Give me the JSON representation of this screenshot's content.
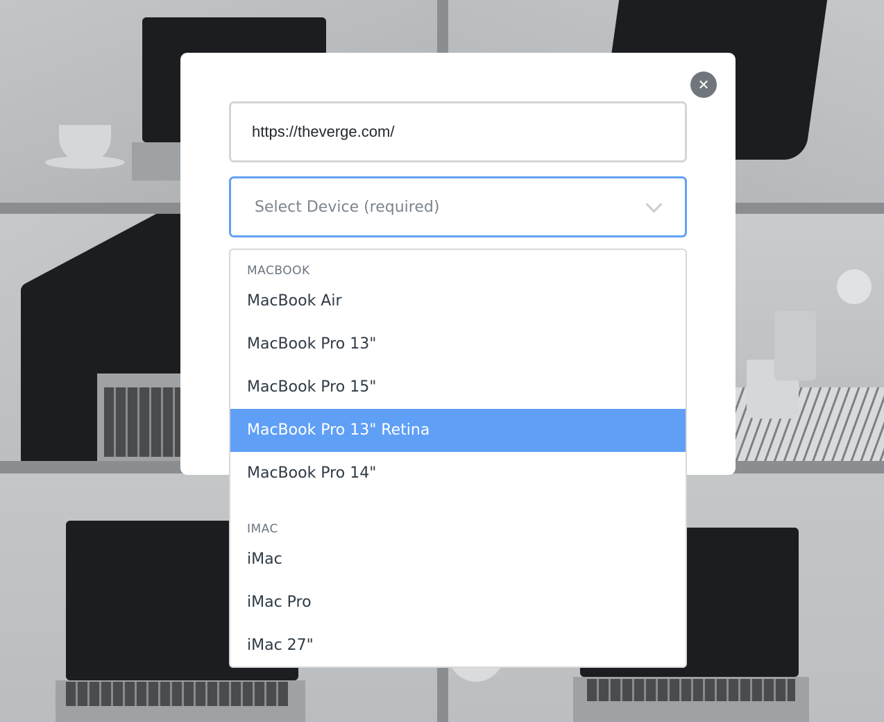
{
  "url_input": {
    "value": "https://theverge.com/"
  },
  "device_select": {
    "placeholder": "Select Device (required)"
  },
  "close_button": {
    "glyph": "✕"
  },
  "dropdown": {
    "groups": [
      {
        "label": "MACBOOK",
        "options": [
          "MacBook Air",
          "MacBook Pro 13\"",
          "MacBook Pro 15\"",
          "MacBook Pro 13\" Retina",
          "MacBook Pro 14\""
        ]
      },
      {
        "label": "IMAC",
        "options": [
          "iMac",
          "iMac Pro",
          "iMac 27\""
        ]
      }
    ],
    "highlighted_option": "MacBook Pro 13\" Retina"
  },
  "colors": {
    "accent": "#5f9ff6",
    "select_border": "#63a1f6",
    "close_button_bg": "#71767c",
    "overlay": "#8b8e91"
  }
}
